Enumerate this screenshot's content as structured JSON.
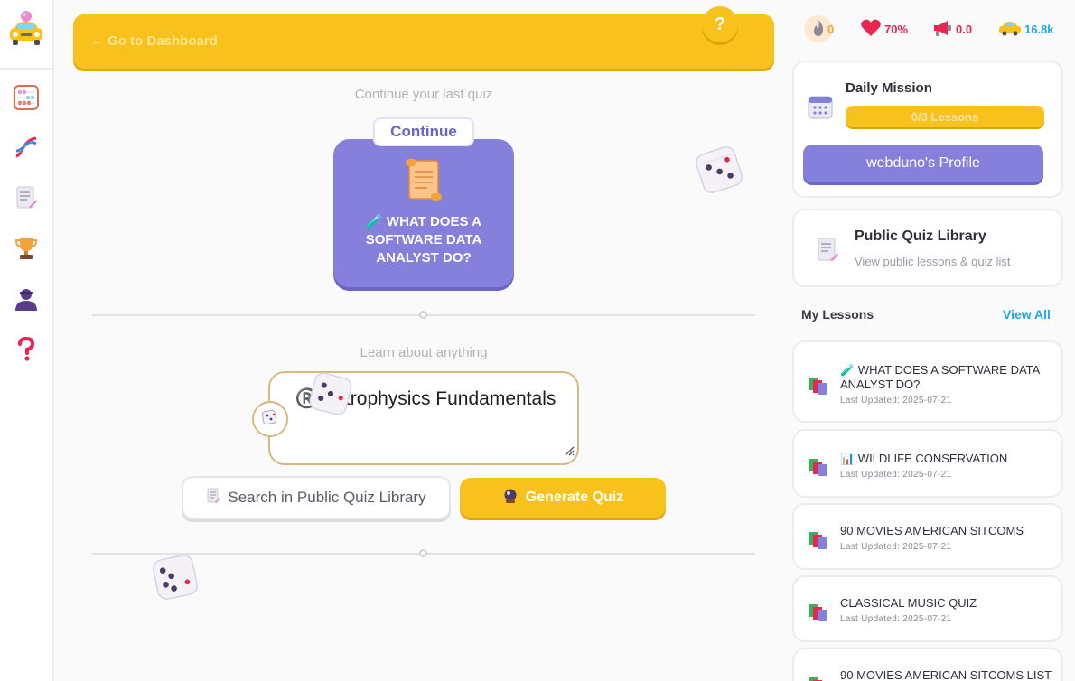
{
  "nav": {
    "back_label": "← Go to Dashboard",
    "help_label": "?"
  },
  "main": {
    "continue_caption": "Continue your last quiz",
    "continue_tag": "Continue",
    "last_quiz_title": "🧪 What does a software data analyst do?",
    "learn_caption": "Learn about anything",
    "topic_value": "®️ Astrophysics Fundamentals",
    "search_label": "Search in Public Quiz Library",
    "generate_label": "Generate Quiz"
  },
  "stats": {
    "streak": "0",
    "health": "70%",
    "boost": "0.0",
    "coins": "16.8k",
    "colors": {
      "streak": "#f0a43a",
      "health": "#e8264e",
      "boost": "#e8264e",
      "coins": "#1ea7ea"
    }
  },
  "daily_mission": {
    "title": "Daily Mission",
    "progress_text": "0/3 Lessons",
    "progress": 0,
    "profile_button": "webduno's Profile"
  },
  "library": {
    "title": "Public Quiz Library",
    "subtitle": "View public lessons & quiz list"
  },
  "lessons": {
    "header": "My Lessons",
    "view_all": "View All",
    "items": [
      {
        "title": "🧪 What does a software data analyst do?",
        "updated": "Last Updated: 2025-07-21"
      },
      {
        "title": "📊 Wildlife Conservation",
        "updated": "Last Updated: 2025-07-21"
      },
      {
        "title": "90 Movies American Sitcoms",
        "updated": "Last Updated: 2025-07-21"
      },
      {
        "title": "Classical Music Quiz",
        "updated": "Last Updated: 2025-07-21"
      },
      {
        "title": "90 Movies American Sitcoms List",
        "updated": ""
      }
    ]
  },
  "theme": {
    "accent": "#f8c11b",
    "purple": "#8580dc",
    "link": "#1ea7ea"
  }
}
